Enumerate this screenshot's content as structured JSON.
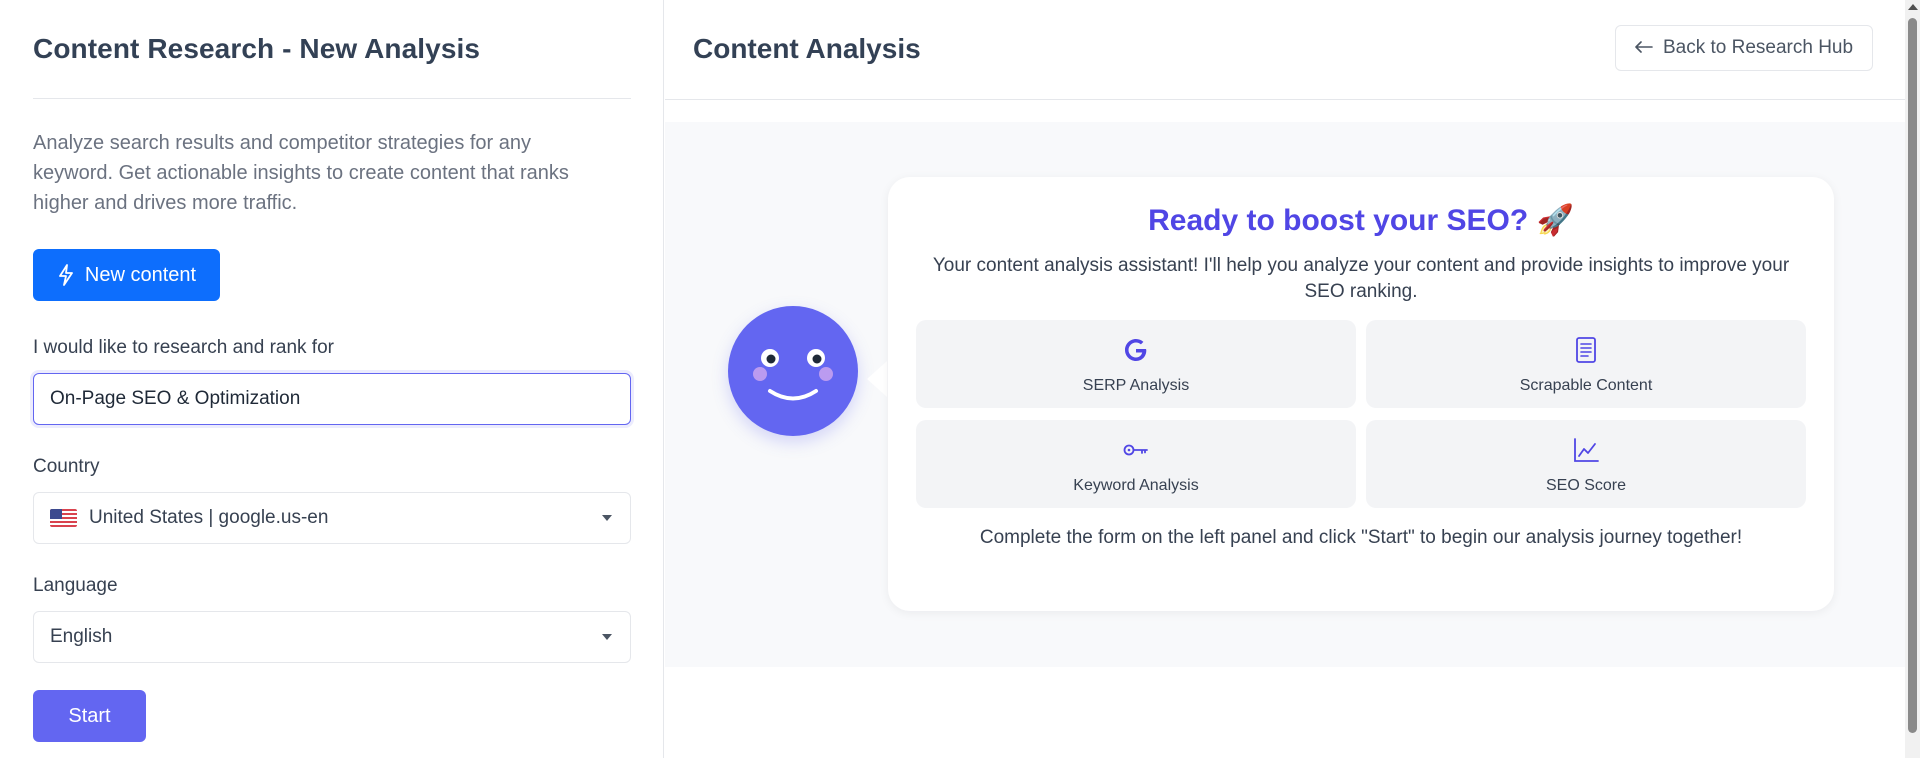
{
  "left": {
    "title": "Content Research - New Analysis",
    "description": "Analyze search results and competitor strategies for any keyword. Get actionable insights to create content that ranks higher and drives more traffic.",
    "new_content_label": "New content",
    "research_label": "I would like to research and rank for",
    "keyword_value": "On-Page SEO & Optimization",
    "country_label": "Country",
    "country_value": "United States | google.us-en",
    "language_label": "Language",
    "language_value": "English",
    "start_label": "Start"
  },
  "right": {
    "title": "Content Analysis",
    "back_label": "Back to Research Hub",
    "card": {
      "title": "Ready to boost your SEO? 🚀",
      "subtitle": "Your content analysis assistant! I'll help you analyze your content and provide insights to improve your SEO ranking.",
      "features": [
        {
          "label": "SERP Analysis",
          "icon": "google-icon"
        },
        {
          "label": "Scrapable Content",
          "icon": "document-icon"
        },
        {
          "label": "Keyword Analysis",
          "icon": "key-icon"
        },
        {
          "label": "SEO Score",
          "icon": "line-chart-icon"
        }
      ],
      "footer": "Complete the form on the left panel and click \"Start\" to begin our analysis journey together!"
    }
  },
  "colors": {
    "primary_blue": "#0d6efd",
    "indigo": "#6366f1",
    "title_indigo": "#5046e5"
  }
}
